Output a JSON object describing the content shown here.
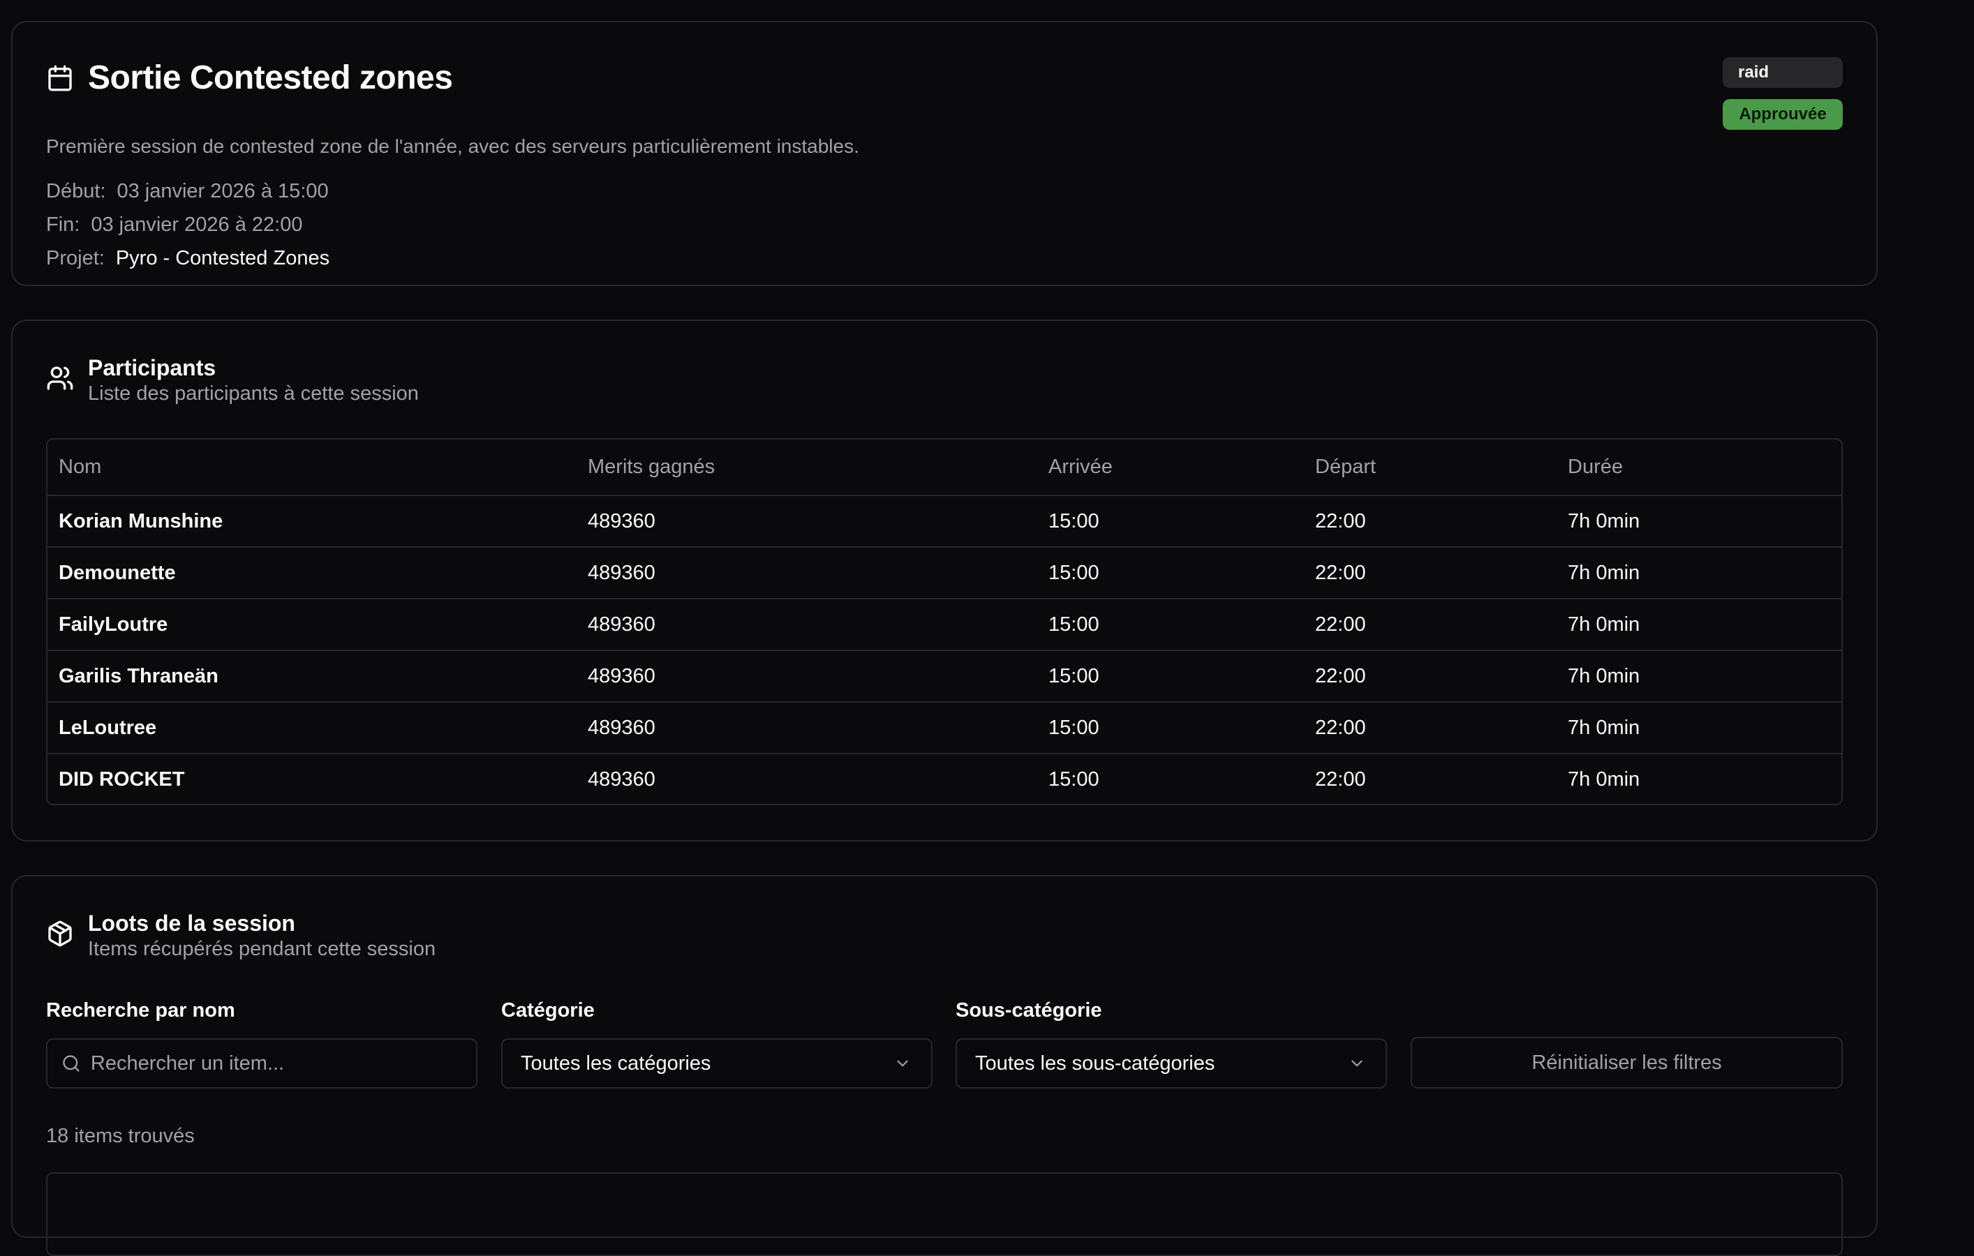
{
  "session": {
    "title": "Sortie Contested zones",
    "description": "Première session de contested zone de l'année, avec des serveurs particulièrement instables.",
    "start_label": "Début:",
    "start_value": "03 janvier 2026 à 15:00",
    "end_label": "Fin:",
    "end_value": "03 janvier 2026 à 22:00",
    "project_label": "Projet:",
    "project_value": "Pyro - Contested Zones",
    "type_badge": "raid",
    "status_badge": "Approuvée",
    "status_color": "#4a9a4a"
  },
  "participants": {
    "title": "Participants",
    "subtitle": "Liste des participants à cette session",
    "columns": [
      "Nom",
      "Merits gagnés",
      "Arrivée",
      "Départ",
      "Durée"
    ],
    "rows": [
      [
        "Korian Munshine",
        "489360",
        "15:00",
        "22:00",
        "7h 0min"
      ],
      [
        "Demounette",
        "489360",
        "15:00",
        "22:00",
        "7h 0min"
      ],
      [
        "FailyLoutre",
        "489360",
        "15:00",
        "22:00",
        "7h 0min"
      ],
      [
        "Garilis Thraneän",
        "489360",
        "15:00",
        "22:00",
        "7h 0min"
      ],
      [
        "LeLoutree",
        "489360",
        "15:00",
        "22:00",
        "7h 0min"
      ],
      [
        "DID ROCKET",
        "489360",
        "15:00",
        "22:00",
        "7h 0min"
      ]
    ]
  },
  "loots": {
    "title": "Loots de la session",
    "subtitle": "Items récupérés pendant cette session",
    "search_label": "Recherche par nom",
    "search_placeholder": "Rechercher un item...",
    "category_label": "Catégorie",
    "category_value": "Toutes les catégories",
    "subcategory_label": "Sous-catégorie",
    "subcategory_value": "Toutes les sous-catégories",
    "reset_label": "Réinitialiser les filtres",
    "count_text": "18 items trouvés"
  },
  "icons": {
    "session": "calendar-icon",
    "participants": "users-icon",
    "loots": "package-icon",
    "search": "search-icon",
    "dropdown": "chevron-down-icon"
  }
}
